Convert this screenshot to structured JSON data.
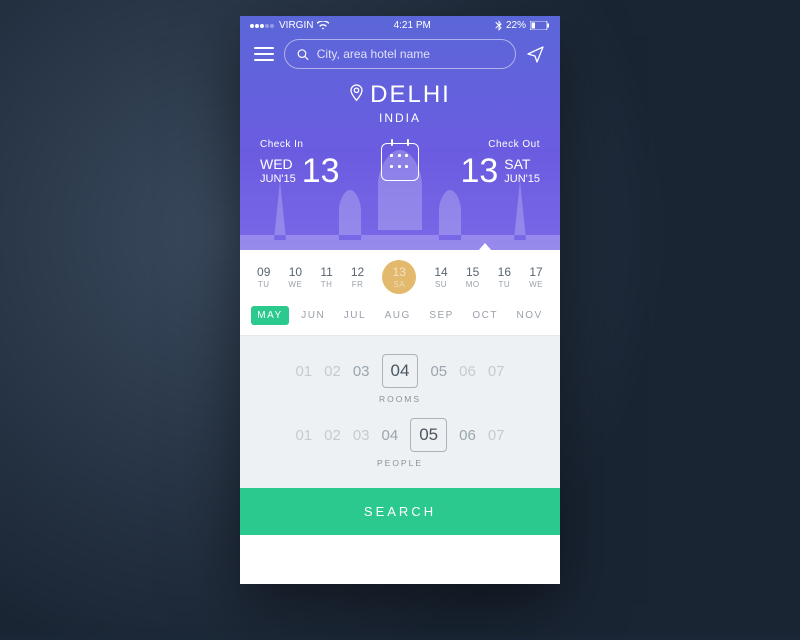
{
  "status": {
    "carrier": "VIRGIN",
    "time": "4:21 PM",
    "battery": "22%"
  },
  "search": {
    "placeholder": "City, area hotel name"
  },
  "location": {
    "city": "DELHI",
    "country": "INDIA"
  },
  "checkin": {
    "label": "Check In",
    "weekday": "WED",
    "daynum": "13",
    "month": "JUN'15"
  },
  "checkout": {
    "label": "Check Out",
    "weekday": "SAT",
    "daynum": "13",
    "month": "JUN'15"
  },
  "days": [
    {
      "n": "09",
      "d": "TU"
    },
    {
      "n": "10",
      "d": "WE"
    },
    {
      "n": "11",
      "d": "TH"
    },
    {
      "n": "12",
      "d": "FR"
    },
    {
      "n": "13",
      "d": "SA"
    },
    {
      "n": "14",
      "d": "SU"
    },
    {
      "n": "15",
      "d": "MO"
    },
    {
      "n": "16",
      "d": "TU"
    },
    {
      "n": "17",
      "d": "WE"
    }
  ],
  "day_selected_index": 4,
  "months": [
    "MAY",
    "JUN",
    "JUL",
    "AUG",
    "SEP",
    "OCT",
    "NOV"
  ],
  "month_selected_index": 0,
  "rooms": {
    "label": "ROOMS",
    "options": [
      "01",
      "02",
      "03",
      "04",
      "05",
      "06",
      "07"
    ],
    "selected_index": 3
  },
  "people": {
    "label": "PEOPLE",
    "options": [
      "01",
      "02",
      "03",
      "04",
      "05",
      "06",
      "07"
    ],
    "selected_index": 4
  },
  "cta": {
    "search": "SEARCH"
  }
}
